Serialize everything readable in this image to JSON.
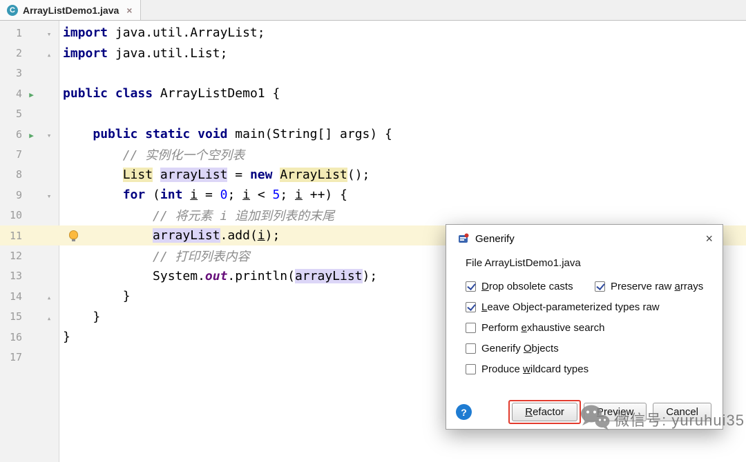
{
  "tab_bar": {
    "tab": {
      "title": "ArrayListDemo1.java",
      "icon_letter": "C",
      "close": "×"
    }
  },
  "editor": {
    "lines": [
      {
        "n": 1,
        "fold": "open",
        "tokens": [
          [
            "import",
            "kw"
          ],
          [
            " java.util.ArrayList;",
            ""
          ]
        ]
      },
      {
        "n": 2,
        "fold": "close",
        "tokens": [
          [
            "import",
            "kw"
          ],
          [
            " java.util.List;",
            ""
          ]
        ]
      },
      {
        "n": 3,
        "tokens": []
      },
      {
        "n": 4,
        "run": true,
        "tokens": [
          [
            "public",
            "kw"
          ],
          [
            " ",
            ""
          ],
          [
            "class",
            "kw"
          ],
          [
            " ArrayListDemo1 {",
            ""
          ]
        ]
      },
      {
        "n": 5,
        "tokens": []
      },
      {
        "n": 6,
        "run": true,
        "fold": "open",
        "tokens": [
          [
            "    ",
            ""
          ],
          [
            "public",
            "kw"
          ],
          [
            " ",
            ""
          ],
          [
            "static",
            "kw"
          ],
          [
            " ",
            ""
          ],
          [
            "void",
            "kw"
          ],
          [
            " main(String[] args) {",
            ""
          ]
        ]
      },
      {
        "n": 7,
        "tokens": [
          [
            "        ",
            ""
          ],
          [
            "// 实例化一个空列表",
            "cm"
          ]
        ]
      },
      {
        "n": 8,
        "tokens": [
          [
            "        ",
            ""
          ],
          [
            "List",
            "hlY"
          ],
          [
            " ",
            ""
          ],
          [
            "arrayList",
            "hlP"
          ],
          [
            " = ",
            ""
          ],
          [
            "new",
            "kw"
          ],
          [
            " ",
            ""
          ],
          [
            "ArrayList",
            "hlY"
          ],
          [
            "();",
            ""
          ]
        ]
      },
      {
        "n": 9,
        "fold": "open",
        "tokens": [
          [
            "        ",
            ""
          ],
          [
            "for",
            "kw"
          ],
          [
            " (",
            ""
          ],
          [
            "int",
            "kw"
          ],
          [
            " ",
            ""
          ],
          [
            "i",
            "un"
          ],
          [
            " = ",
            ""
          ],
          [
            "0",
            "nm"
          ],
          [
            "; ",
            ""
          ],
          [
            "i",
            "un"
          ],
          [
            " < ",
            ""
          ],
          [
            "5",
            "nm"
          ],
          [
            "; ",
            ""
          ],
          [
            "i",
            "un"
          ],
          [
            " ++) {",
            ""
          ]
        ]
      },
      {
        "n": 10,
        "tokens": [
          [
            "            ",
            ""
          ],
          [
            "// 将元素 i 追加到列表的末尾",
            "cm"
          ]
        ]
      },
      {
        "n": 11,
        "hl": true,
        "bulb": true,
        "tokens": [
          [
            "            ",
            ""
          ],
          [
            "arrayList",
            "hlP"
          ],
          [
            ".add(",
            ""
          ],
          [
            "i",
            "un"
          ],
          [
            ");",
            ""
          ]
        ]
      },
      {
        "n": 12,
        "tokens": [
          [
            "            ",
            ""
          ],
          [
            "// 打印列表内容",
            "cm"
          ]
        ]
      },
      {
        "n": 13,
        "tokens": [
          [
            "            ",
            ""
          ],
          [
            "System.",
            ""
          ],
          [
            "out",
            "fld"
          ],
          [
            ".println(",
            ""
          ],
          [
            "arrayList",
            "hlP"
          ],
          [
            ");",
            ""
          ]
        ]
      },
      {
        "n": 14,
        "fold": "close",
        "tokens": [
          [
            "        }",
            ""
          ]
        ]
      },
      {
        "n": 15,
        "fold": "close",
        "tokens": [
          [
            "    }",
            ""
          ]
        ]
      },
      {
        "n": 16,
        "tokens": [
          [
            "}",
            ""
          ]
        ]
      },
      {
        "n": 17,
        "tokens": []
      }
    ]
  },
  "dialog": {
    "title": "Generify",
    "close": "×",
    "file_label": "File ArrayListDemo1.java",
    "checkboxes": [
      {
        "pre": "",
        "m": "D",
        "post": "rop obsolete casts",
        "checked": true
      },
      {
        "pre": "Preserve raw ",
        "m": "a",
        "post": "rrays",
        "checked": true
      },
      {
        "pre": "",
        "m": "L",
        "post": "eave Object-parameterized types raw",
        "checked": true
      },
      {
        "pre": "Perform ",
        "m": "e",
        "post": "xhaustive search",
        "checked": false
      },
      {
        "pre": "Generify ",
        "m": "O",
        "post": "bjects",
        "checked": false
      },
      {
        "pre": "Produce ",
        "m": "w",
        "post": "ildcard types",
        "checked": false
      }
    ],
    "help": "?",
    "buttons": [
      {
        "pre": "",
        "m": "R",
        "post": "efactor",
        "annotated": true
      },
      {
        "pre": "",
        "m": "P",
        "post": "review",
        "annotated": false
      },
      {
        "pre": "Cancel",
        "m": "",
        "post": "",
        "annotated": false
      }
    ]
  },
  "watermark": {
    "text": "微信号: yuruhui35"
  },
  "colors": {
    "keyword": "#000080",
    "comment": "#8C8C8C",
    "number": "#0000FF",
    "static_field": "#660E7A",
    "usage_highlight_yellow": "#F3EBB6",
    "usage_highlight_purple": "#DCD6F7",
    "line_highlight": "#FBF5D7",
    "annotation_red": "#E23B2E",
    "run_arrow_green": "#59A869"
  }
}
